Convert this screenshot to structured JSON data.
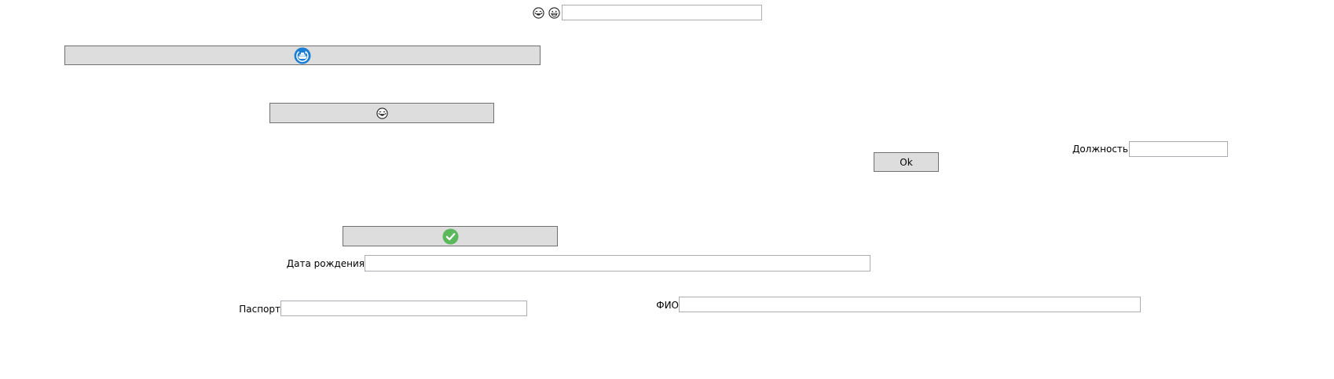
{
  "top_bar": {
    "icons": [
      "laughing-face-icon",
      "grinning-face-icon"
    ],
    "input_value": ""
  },
  "buttons": {
    "ship_button_icon": "ship-refresh-icon",
    "emoji_button_icon": "laughing-face-icon",
    "ok_label": "Ok",
    "confirm_button_icon": "green-check-icon"
  },
  "fields": {
    "position": {
      "label": "Должность",
      "value": ""
    },
    "birth_date": {
      "label": "Дата рождения",
      "value": ""
    },
    "passport": {
      "label": "Паспорт",
      "value": ""
    },
    "full_name": {
      "label": "ФИО",
      "value": ""
    }
  },
  "colors": {
    "button_bg": "#dddddd",
    "button_border": "#707070",
    "field_border": "#abadb3",
    "accent_blue": "#1a7fd4",
    "check_green": "#5cb85c"
  }
}
